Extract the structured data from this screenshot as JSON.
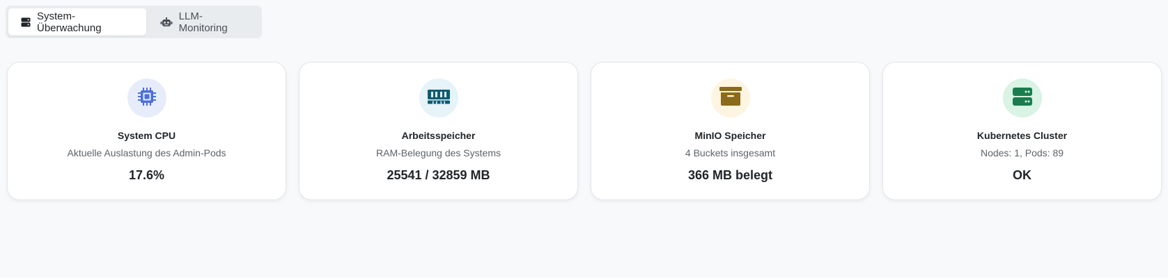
{
  "tabs": [
    {
      "label": "System-Überwachung",
      "icon": "server-icon",
      "active": true
    },
    {
      "label": "LLM-Monitoring",
      "icon": "robot-icon",
      "active": false
    }
  ],
  "cards": [
    {
      "title": "System CPU",
      "subtitle": "Aktuelle Auslastung des Admin-Pods",
      "value": "17.6%",
      "icon": "cpu-icon",
      "icon_bg": "#e7ecfb",
      "icon_color": "#4a6fd8"
    },
    {
      "title": "Arbeitsspeicher",
      "subtitle": "RAM-Belegung des Systems",
      "value": "25541 / 32859 MB",
      "icon": "memory-icon",
      "icon_bg": "#e6f3f8",
      "icon_color": "#0b5c73"
    },
    {
      "title": "MinIO Speicher",
      "subtitle": "4 Buckets insgesamt",
      "value": "366 MB belegt",
      "icon": "archive-icon",
      "icon_bg": "#fdf5e2",
      "icon_color": "#8b6a1c"
    },
    {
      "title": "Kubernetes Cluster",
      "subtitle": "Nodes: 1, Pods: 89",
      "value": "OK",
      "icon": "server-icon",
      "icon_bg": "#d9f3e4",
      "icon_color": "#1b7d4f"
    }
  ]
}
